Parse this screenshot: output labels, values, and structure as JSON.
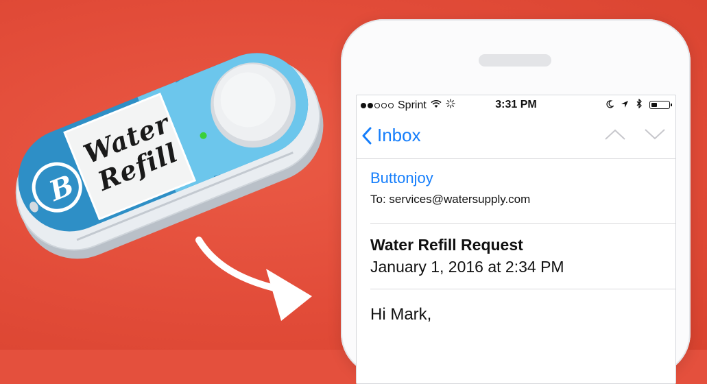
{
  "button": {
    "label_line1": "Water",
    "label_line2": "Refill",
    "logo_letter": "B",
    "colors": {
      "body": "#2e8fc6",
      "light_blue": "#6cc6ec",
      "base": "#e8ecf0",
      "led": "#3ad03a"
    }
  },
  "phone": {
    "status": {
      "carrier": "Sprint",
      "time": "3:31 PM",
      "signal_bars_filled": 2,
      "signal_bars_total": 5,
      "icons": [
        "wifi-icon",
        "activity-spinner-icon",
        "moon-icon",
        "location-arrow-icon",
        "bluetooth-icon",
        "battery-icon"
      ],
      "battery_level": 0.35
    },
    "nav": {
      "back_label": "Inbox",
      "back_icon": "chevron-left-icon",
      "prev_icon": "chevron-up-icon",
      "next_icon": "chevron-down-icon"
    },
    "email": {
      "sender": "Buttonjoy",
      "to": "To: services@watersupply.com",
      "subject": "Water Refill Request",
      "date": "January 1, 2016 at 2:34 PM",
      "body_greeting": "Hi Mark,"
    },
    "colors": {
      "accent": "#157efb"
    }
  },
  "background_color": "#e4503d"
}
